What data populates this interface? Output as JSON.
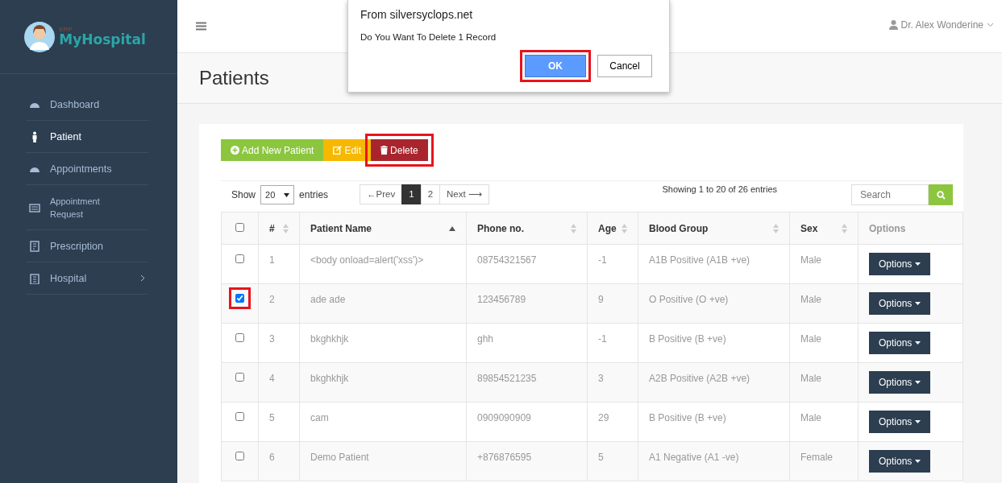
{
  "sidebar": {
    "logo": {
      "tag": "ERP",
      "name": "MyHospital"
    },
    "items": [
      {
        "label": "Dashboard",
        "kind": "gauge",
        "selected": false,
        "submenu": false
      },
      {
        "label": "Patient",
        "kind": "person",
        "selected": true,
        "submenu": false
      },
      {
        "label": "Appointments",
        "kind": "gauge",
        "selected": false,
        "submenu": false
      },
      {
        "label": "Appointment Request",
        "kind": "card",
        "selected": false,
        "submenu": false
      },
      {
        "label": "Prescription",
        "kind": "doc",
        "selected": false,
        "submenu": false
      },
      {
        "label": "Hospital",
        "kind": "building",
        "selected": false,
        "submenu": true
      }
    ]
  },
  "topbar": {
    "user": "Dr. Alex Wonderine"
  },
  "page_title": "Patients",
  "actions": [
    {
      "kind": "add",
      "label": "Add New Patient",
      "highlighted": false
    },
    {
      "kind": "edit",
      "label": "Edit",
      "highlighted": false
    },
    {
      "kind": "delete",
      "label": "Delete",
      "highlighted": true
    }
  ],
  "table_controls": {
    "show_label": "Show",
    "page_size": "20",
    "entries_label": "entries",
    "pagination": [
      {
        "label": "←Prev",
        "selected": false
      },
      {
        "label": "1",
        "selected": true
      },
      {
        "label": "2",
        "selected": false
      },
      {
        "label": "Next ⟶",
        "selected": false
      }
    ],
    "info": "Showing 1 to 20 of 26 entries",
    "search": {
      "placeholder": "Search"
    }
  },
  "table": {
    "select_all": {
      "checked": false
    },
    "columns": [
      {
        "label": "#",
        "kind": "sortable"
      },
      {
        "label": "Patient Name",
        "kind": "sorted_asc"
      },
      {
        "label": "Phone no.",
        "kind": "sortable"
      },
      {
        "label": "Age",
        "kind": "sortable"
      },
      {
        "label": "Blood Group",
        "kind": "sortable"
      },
      {
        "label": "Sex",
        "kind": "sortable"
      },
      {
        "label": "Options",
        "kind": "plain"
      }
    ],
    "rows": [
      {
        "checked": false,
        "highlighted": false,
        "cells": [
          "1",
          "<body onload=alert('xss')>",
          "08754321567",
          "-1",
          "A1B Positive (A1B +ve)",
          "Male"
        ],
        "action": "Options"
      },
      {
        "checked": true,
        "highlighted": true,
        "cells": [
          "2",
          "ade ade",
          "123456789",
          "9",
          "O Positive (O +ve)",
          "Male"
        ],
        "action": "Options"
      },
      {
        "checked": false,
        "highlighted": false,
        "cells": [
          "3",
          "bkghkhjk",
          "ghh",
          "-1",
          "B Positive (B +ve)",
          "Male"
        ],
        "action": "Options"
      },
      {
        "checked": false,
        "highlighted": false,
        "cells": [
          "4",
          "bkghkhjk",
          "89854521235",
          "3",
          "A2B Positive (A2B +ve)",
          "Male"
        ],
        "action": "Options"
      },
      {
        "checked": false,
        "highlighted": false,
        "cells": [
          "5",
          "cam",
          "0909090909",
          "29",
          "B Positive (B +ve)",
          "Male"
        ],
        "action": "Options"
      },
      {
        "checked": false,
        "highlighted": false,
        "cells": [
          "6",
          "Demo Patient",
          "+876876595",
          "5",
          "A1 Negative (A1 -ve)",
          "Female"
        ],
        "action": "Options"
      }
    ]
  },
  "dialog": {
    "title": "From silversyclops.net",
    "message": "Do You Want To Delete 1 Record",
    "buttons": [
      {
        "kind": "primary",
        "label": "OK",
        "highlighted": true
      },
      {
        "kind": "secondary",
        "label": "Cancel",
        "highlighted": false
      }
    ]
  }
}
